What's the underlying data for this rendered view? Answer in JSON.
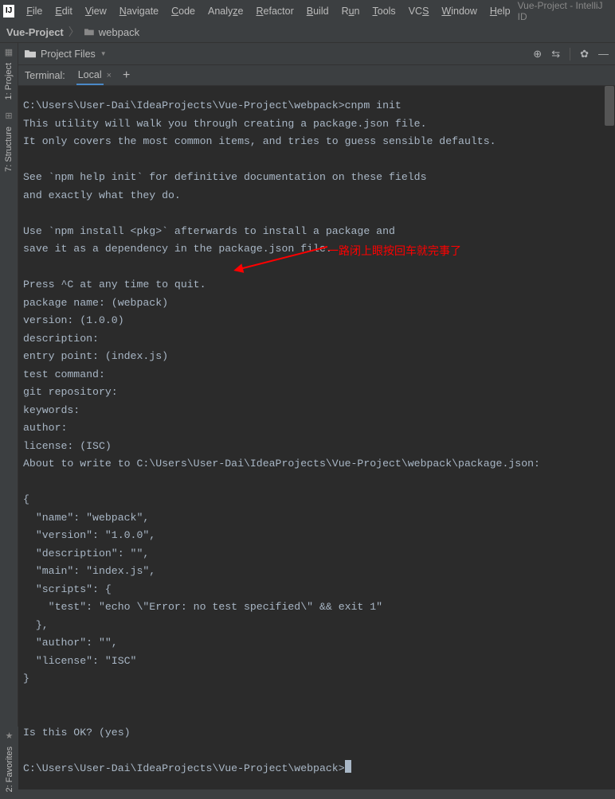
{
  "window": {
    "title": "Vue-Project - IntelliJ ID"
  },
  "menu": {
    "file": "File",
    "edit": "Edit",
    "view": "View",
    "navigate": "Navigate",
    "code": "Code",
    "analyze": "Analyze",
    "refactor": "Refactor",
    "build": "Build",
    "run": "Run",
    "tools": "Tools",
    "vcs": "VCS",
    "window": "Window",
    "help": "Help"
  },
  "breadcrumb": {
    "root": "Vue-Project",
    "child": "webpack"
  },
  "left_rail": {
    "project": "1: Project",
    "structure": "7: Structure",
    "favorites": "2: Favorites"
  },
  "toolbar": {
    "project_files": "Project Files"
  },
  "tabs": {
    "terminal": "Terminal:",
    "local": "Local"
  },
  "annotation": "一路闭上眼按回车就完事了",
  "term": {
    "l01": "C:\\Users\\User-Dai\\IdeaProjects\\Vue-Project\\webpack>cnpm init",
    "l02": "This utility will walk you through creating a package.json file.",
    "l03": "It only covers the most common items, and tries to guess sensible defaults.",
    "l04": "",
    "l05": "See `npm help init` for definitive documentation on these fields",
    "l06": "and exactly what they do.",
    "l07": "",
    "l08": "Use `npm install <pkg>` afterwards to install a package and",
    "l09": "save it as a dependency in the package.json file.",
    "l10": "",
    "l11": "Press ^C at any time to quit.",
    "l12": "package name: (webpack)",
    "l13": "version: (1.0.0)",
    "l14": "description:",
    "l15": "entry point: (index.js)",
    "l16": "test command:",
    "l17": "git repository:",
    "l18": "keywords:",
    "l19": "author:",
    "l20": "license: (ISC)",
    "l21": "About to write to C:\\Users\\User-Dai\\IdeaProjects\\Vue-Project\\webpack\\package.json:",
    "l22": "",
    "l23": "{",
    "l24": "  \"name\": \"webpack\",",
    "l25": "  \"version\": \"1.0.0\",",
    "l26": "  \"description\": \"\",",
    "l27": "  \"main\": \"index.js\",",
    "l28": "  \"scripts\": {",
    "l29": "    \"test\": \"echo \\\"Error: no test specified\\\" && exit 1\"",
    "l30": "  },",
    "l31": "  \"author\": \"\",",
    "l32": "  \"license\": \"ISC\"",
    "l33": "}",
    "l34": "",
    "l35": "",
    "l36": "Is this OK? (yes)",
    "l37": "",
    "l38": "C:\\Users\\User-Dai\\IdeaProjects\\Vue-Project\\webpack>"
  }
}
